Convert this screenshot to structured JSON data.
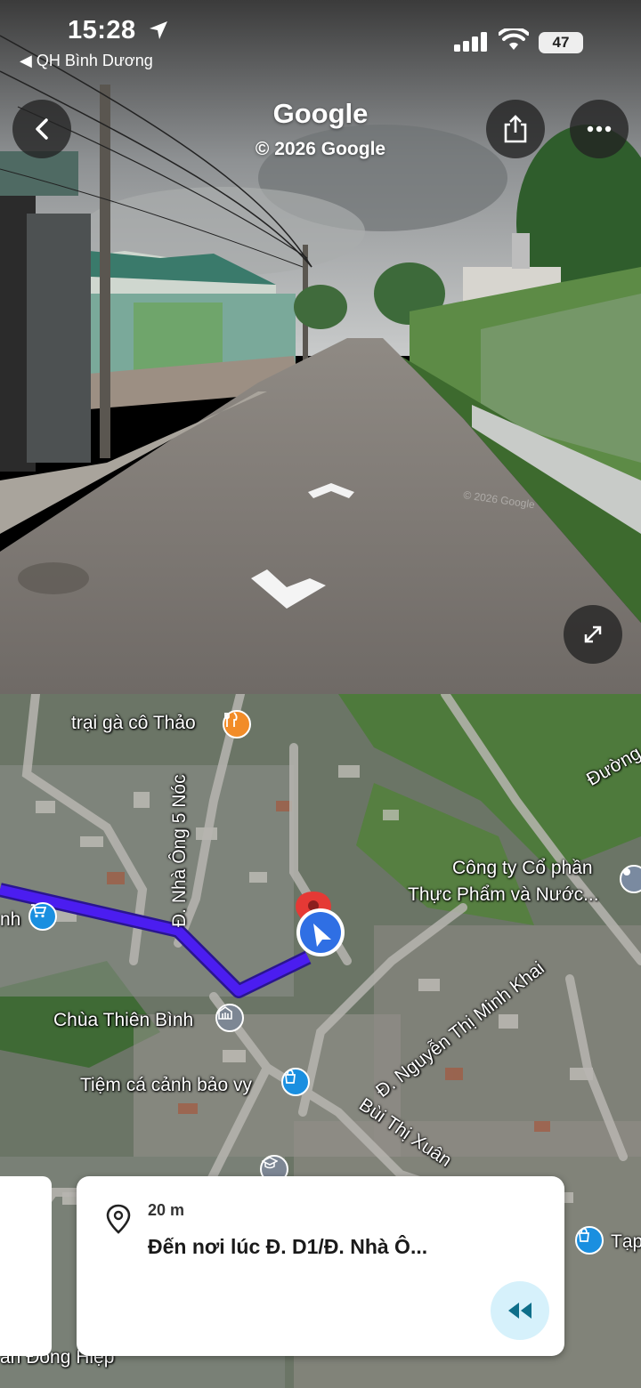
{
  "status_bar": {
    "time": "15:28",
    "back_app": "◀ QH Bình Dương",
    "battery": "47",
    "location_icon": "location-arrow-icon"
  },
  "street_view": {
    "brand": "Google",
    "copyright": "© 2026 Google",
    "back_icon": "chevron-left-icon",
    "share_icon": "share-icon",
    "more_icon": "more-dots-icon",
    "expand_icon": "expand-icon",
    "colors": {
      "button_bg": "#2a2a2a"
    }
  },
  "map": {
    "labels": {
      "farm": "trại gà cô Thảo",
      "street_5noc": "Đ. Nhà Ông 5 Nóc",
      "street_duong": "Đường",
      "company_line1": "Công ty Cổ phần",
      "company_line2": "Thực Phẩm và Nước...",
      "temple": "Chùa Thiên Bình",
      "fish_shop": "Tiệm cá cảnh bảo vy",
      "street_nguyen": "Đ. Nguyễn Thị Minh Khai",
      "street_bui": "Bùi Thị Xuân",
      "partial_nh": "nh",
      "partial_tap": "Tạp",
      "partial_dong_hiep": "ân Đông Hiệp"
    },
    "colors": {
      "route": "#4b1df0",
      "pin": "#e53935",
      "user_dot": "#2f6fe4"
    }
  },
  "nav_card": {
    "distance": "20 m",
    "instruction": "Đến nơi lúc Đ. D1/Đ. Nhà Ô...",
    "pin_icon": "location-pin-icon",
    "rewind_icon": "rewind-icon"
  }
}
